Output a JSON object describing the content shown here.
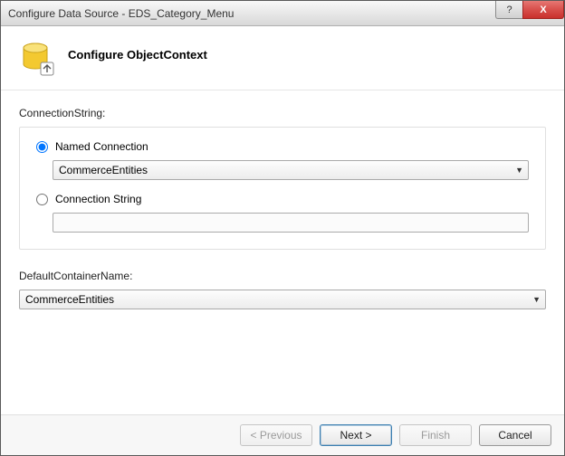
{
  "window": {
    "title": "Configure Data Source - EDS_Category_Menu"
  },
  "header": {
    "title": "Configure ObjectContext"
  },
  "connection": {
    "label": "ConnectionString:",
    "named_radio_label": "Named Connection",
    "named_selected": "CommerceEntities",
    "string_radio_label": "Connection String",
    "string_value": ""
  },
  "container": {
    "label": "DefaultContainerName:",
    "selected": "CommerceEntities"
  },
  "buttons": {
    "previous": "< Previous",
    "next": "Next >",
    "finish": "Finish",
    "cancel": "Cancel"
  },
  "titlebar": {
    "help": "?",
    "close": "X"
  }
}
